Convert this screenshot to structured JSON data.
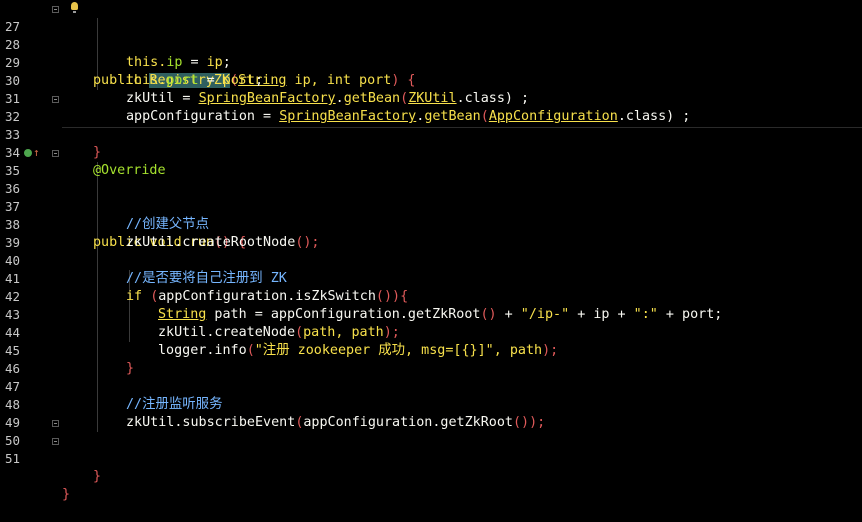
{
  "gutter": {
    "line_numbers": [
      "27",
      "28",
      "29",
      "30",
      "31",
      "32",
      "33",
      "34",
      "35",
      "36",
      "37",
      "38",
      "39",
      "40",
      "41",
      "42",
      "43",
      "44",
      "45",
      "46",
      "47",
      "48",
      "49",
      "50",
      "51"
    ]
  },
  "code": {
    "l27": {
      "t1": "public ",
      "t2": "RegistryZK",
      "t3": "(",
      "t4": "String",
      "t5": " ip, ",
      "t6": "int",
      "t7": " port",
      ") ": "",
      "t8": ") {"
    },
    "l28": {
      "t1": "this.",
      "t2": "ip",
      "t3": " = ",
      "t4": "ip",
      ";": ";"
    },
    "l29": {
      "t1": "this.",
      "t2": "port",
      "t3": " = ",
      "t4": "port",
      ";": ";"
    },
    "l30": {
      "t1": "zkUtil = ",
      "t2": "SpringBeanFactory",
      "t3": ".",
      "t4": "getBean",
      "t5": "(",
      "t6": "ZKUtil",
      "t7": ".class) ;"
    },
    "l31": {
      "t1": "appConfiguration = ",
      "t2": "SpringBeanFactory",
      "t3": ".",
      "t4": "getBean",
      "t5": "(",
      "t6": "AppConfiguration",
      "t7": ".class) ;"
    },
    "l32": {
      "t1": "}"
    },
    "l34": {
      "t1": "@Override"
    },
    "l35": {
      "t1": "public void ",
      "t2": "run",
      "t3": "() {"
    },
    "l37": {
      "t1": "//创建父节点"
    },
    "l38": {
      "t1": "zkUtil.createRootNode",
      "t2": "();"
    },
    "l40": {
      "t1": "//是否要将自己注册到 ZK"
    },
    "l41": {
      "t1": "if ",
      "t2": "(",
      "t3": "appConfiguration.isZkSwitch",
      "t4": "()",
      "t5": "){"
    },
    "l42": {
      "t1": "String",
      "t2": " path = appConfiguration.getZkRoot",
      "t3": "()",
      "t4": " + ",
      "t5": "\"/ip-\"",
      "t6": " + ip + ",
      "t7": "\":\"",
      "t8": " + port;"
    },
    "l43": {
      "t1": "zkUtil.createNode",
      "t2": "(",
      "t3": "path, path",
      "t4": ");"
    },
    "l44": {
      "t1": "logger.info",
      "t2": "(",
      "t3": "\"注册 zookeeper 成功, msg=[{}]\"",
      "t4": ", path",
      ")": ");"
    },
    "l45": {
      "t1": "}"
    },
    "l47": {
      "t1": "//注册监听服务"
    },
    "l48": {
      "t1": "zkUtil.subscribeEvent",
      "t2": "(",
      "t3": "appConfiguration.getZkRoot",
      "t4": "()",
      "t5": ");"
    },
    "l50": {
      "t1": "}"
    },
    "l51": {
      "t1": "}"
    }
  },
  "colors": {
    "background": "#000000",
    "keyword": "#f7e04b",
    "comment": "#76b6ff",
    "annotation": "#a6e22e",
    "brace": "#e05a5a",
    "highlight": "#2f5f5f"
  },
  "icons": [
    "bulb-icon",
    "override-gutter-icon",
    "fold-marker-icon"
  ]
}
